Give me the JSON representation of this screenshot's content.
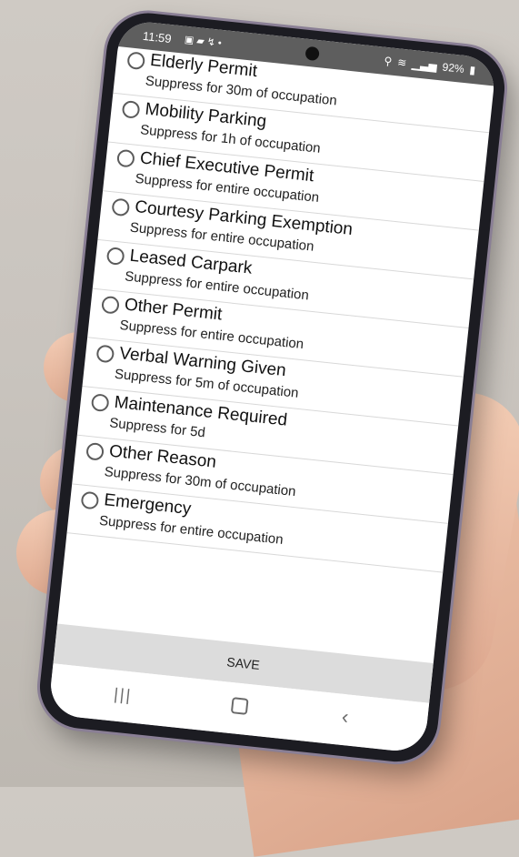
{
  "status_bar": {
    "time": "11:59",
    "notification_icons": [
      "gallery-icon",
      "image-icon",
      "phone-missed-icon",
      "dot-icon"
    ],
    "battery": "92%",
    "icons": [
      "location-icon",
      "wifi-icon",
      "volte-icon",
      "signal-icon",
      "battery-icon"
    ]
  },
  "options": [
    {
      "label": "Elderly Permit",
      "detail": "Suppress for 30m of occupation",
      "selected": false
    },
    {
      "label": "Mobility Parking",
      "detail": "Suppress for 1h of occupation",
      "selected": false
    },
    {
      "label": "Chief Executive Permit",
      "detail": "Suppress for entire occupation",
      "selected": false
    },
    {
      "label": "Courtesy Parking Exemption",
      "detail": "Suppress for entire occupation",
      "selected": false
    },
    {
      "label": "Leased Carpark",
      "detail": "Suppress for entire occupation",
      "selected": false
    },
    {
      "label": "Other Permit",
      "detail": "Suppress for entire occupation",
      "selected": false
    },
    {
      "label": "Verbal Warning Given",
      "detail": "Suppress for 5m of occupation",
      "selected": false
    },
    {
      "label": "Maintenance Required",
      "detail": "Suppress for 5d",
      "selected": false
    },
    {
      "label": "Other Reason",
      "detail": "Suppress for 30m of occupation",
      "selected": false
    },
    {
      "label": "Emergency",
      "detail": "Suppress for entire occupation",
      "selected": false
    }
  ],
  "save_button": {
    "label": "SAVE"
  },
  "nav_bar": {
    "recents_icon": "recents-icon",
    "home_icon": "home-icon",
    "back_icon": "back-icon"
  }
}
